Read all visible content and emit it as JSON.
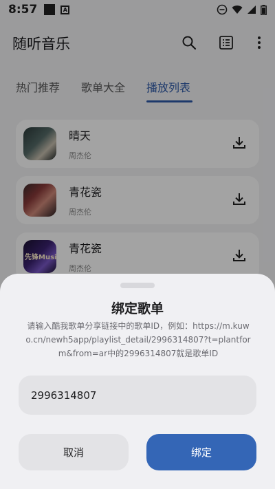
{
  "status_bar": {
    "time": "8:57"
  },
  "app_bar": {
    "title": "随听音乐"
  },
  "tabs": [
    {
      "label": "热门推荐"
    },
    {
      "label": "歌单大全"
    },
    {
      "label": "播放列表"
    }
  ],
  "active_tab_index": 2,
  "songs": [
    {
      "title": "晴天",
      "artist": "周杰伦"
    },
    {
      "title": "青花瓷",
      "artist": "周杰伦"
    },
    {
      "title": "青花瓷",
      "artist": "周杰伦",
      "cover_text": "先锋Music"
    }
  ],
  "dialog": {
    "title": "绑定歌单",
    "description": "请输入酷我歌单分享链接中的歌单ID，例如：https://m.kuwo.cn/newh5app/playlist_detail/2996314807?t=plantform&from=ar中的2996314807就是歌单ID",
    "input_value": "2996314807",
    "cancel_label": "取消",
    "confirm_label": "绑定"
  },
  "colors": {
    "accent": "#3466b6",
    "tab_active": "#2e5aa8"
  }
}
